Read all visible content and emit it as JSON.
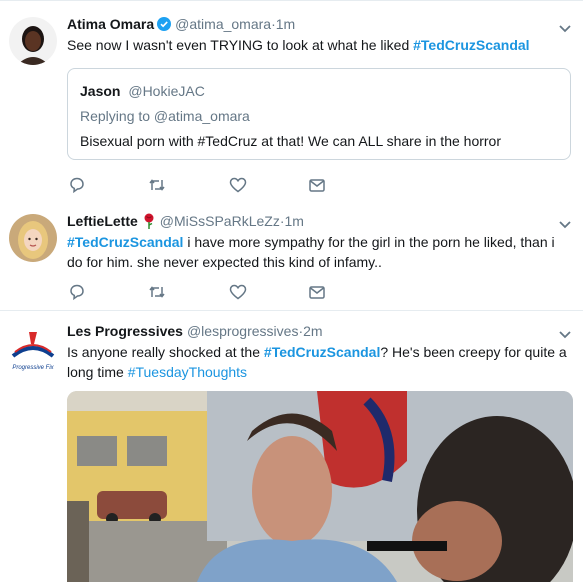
{
  "tweets": [
    {
      "name": "Atima Omara",
      "handle": "@atima_omara",
      "time": "1m",
      "text_plain": "See now I wasn't even TRYING to look at what he liked ",
      "hashtag": "#TedCruzScandal",
      "quote": {
        "name": "Jason",
        "handle": "@HokieJAC",
        "reply": "Replying to @atima_omara",
        "text": "Bisexual porn with #TedCruz at that!  We can ALL share in the horror"
      }
    },
    {
      "name": "LeftieLette",
      "handle": "@MiSsSPaRkLeZz",
      "time": "1m",
      "hashtag": "#TedCruzScandal",
      "text_line1": " i have more sympathy for the girl in the porn he liked, than i",
      "text_line2": "do for him. she never expected this kind of infamy.."
    },
    {
      "name": "Les Progressives",
      "handle": "@lesprogressives",
      "time": "2m",
      "text_part1": "Is anyone really shocked at the ",
      "hashtag": "#TedCruzScandal",
      "text_part2": "? He's been creepy for quite a",
      "text_line2": "long time ",
      "hashtag2": "#TuesdayThoughts",
      "logo_text": "Progressive Fix"
    }
  ],
  "separator": " · ",
  "icons": [
    "reply-icon",
    "retweet-icon",
    "like-icon",
    "dm-icon",
    "caret-down-icon",
    "verified-badge-icon",
    "rose-emoji-icon"
  ],
  "colors": {
    "link": "#1b95e0",
    "muted": "#657786",
    "border": "#e6ecf0"
  }
}
